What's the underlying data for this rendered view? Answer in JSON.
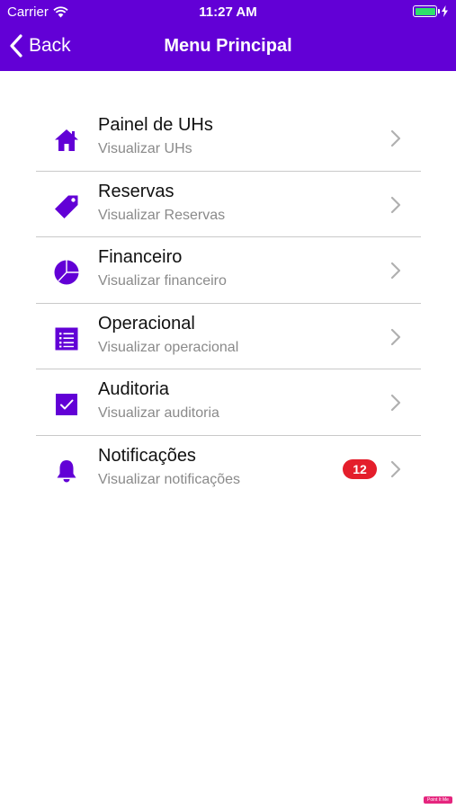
{
  "status_bar": {
    "carrier": "Carrier",
    "time": "11:27 AM",
    "battery_level": 1.0,
    "battery_color": "#2ee06a"
  },
  "nav": {
    "back_label": "Back",
    "title": "Menu Principal"
  },
  "menu": [
    {
      "title": "Painel de UHs",
      "subtitle": "Visualizar UHs",
      "icon": "home-icon"
    },
    {
      "title": "Reservas",
      "subtitle": "Visualizar Reservas",
      "icon": "tag-icon"
    },
    {
      "title": "Financeiro",
      "subtitle": "Visualizar financeiro",
      "icon": "pie-chart-icon"
    },
    {
      "title": "Operacional",
      "subtitle": "Visualizar operacional",
      "icon": "list-icon"
    },
    {
      "title": "Auditoria",
      "subtitle": "Visualizar auditoria",
      "icon": "checkbox-icon"
    },
    {
      "title": "Notificações",
      "subtitle": "Visualizar notificações",
      "icon": "bell-icon",
      "badge": "12"
    }
  ],
  "watermark": "Point It Me",
  "colors": {
    "header": "#6200d6",
    "accent": "#6200d6",
    "badge": "#e41e2b",
    "divider": "#c9c9c9",
    "chevron": "#b0b0b0"
  }
}
